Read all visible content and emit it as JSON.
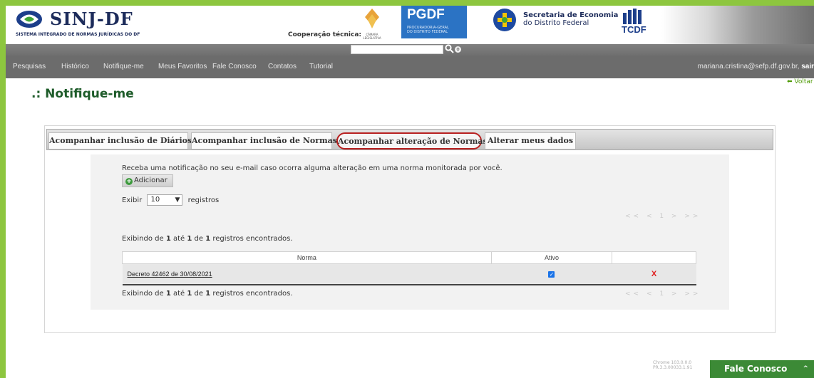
{
  "header": {
    "logo_title": "SINJ-DF",
    "logo_subtitle": "SISTEMA INTEGRADO DE NORMAS JURÍDICAS DO DF",
    "cooperation_label": "Cooperação técnica:",
    "camara_text": "CÂMARA LEGISLATIVA",
    "pgdf_title": "PGDF",
    "pgdf_sub1": "PROCURADORIA-GERAL",
    "pgdf_sub2": "DO DISTRITO FEDERAL",
    "secretaria_title": "Secretaria de Economia",
    "secretaria_sub": "do Distrito Federal",
    "tcdf": "TCDF"
  },
  "search": {
    "placeholder": "",
    "button_icon": "magnifier-icon",
    "options_glyph": "o"
  },
  "nav": {
    "items": [
      "Pesquisas",
      "Histórico",
      "Notifique-me",
      "Meus Favoritos",
      "Fale Conosco",
      "Contatos",
      "Tutorial"
    ],
    "user_email": "mariana.cristina@sefp.df.gov.br,",
    "logout": "sair"
  },
  "voltar": "Voltar",
  "page_title": ".: Notifique-me",
  "tabs": [
    "Acompanhar inclusão de Diários",
    "Acompanhar inclusão de Normas",
    "Acompanhar alteração de Normas",
    "Alterar meus dados"
  ],
  "content": {
    "description": "Receba uma notificação no seu e-mail caso ocorra alguma alteração em uma norma monitorada por você.",
    "add_button": "Adicionar",
    "show_label": "Exibir",
    "show_value": "10",
    "records_label": "registros",
    "pager": "<< < 1 > >>",
    "info_prefix": "Exibindo de",
    "info_from": "1",
    "info_mid": "até",
    "info_to": "1",
    "info_of": "de",
    "info_total": "1",
    "info_suffix": "registros encontrados.",
    "table": {
      "headers": [
        "Norma",
        "Ativo",
        ""
      ],
      "rows": [
        {
          "norma": "Decreto 42462 de 30/08/2021",
          "ativo": true,
          "delete": "X"
        }
      ]
    }
  },
  "footer": {
    "version1": "Chrome 103.0.0.0",
    "version2": "PR.3.3.00033.1.91",
    "fale": "Fale Conosco",
    "caret": "^"
  },
  "colors": {
    "accent_green": "#8dc63f",
    "nav_gray": "#6c6c6c",
    "active_tab_border": "#b82020",
    "fale_green": "#3c8a36"
  }
}
